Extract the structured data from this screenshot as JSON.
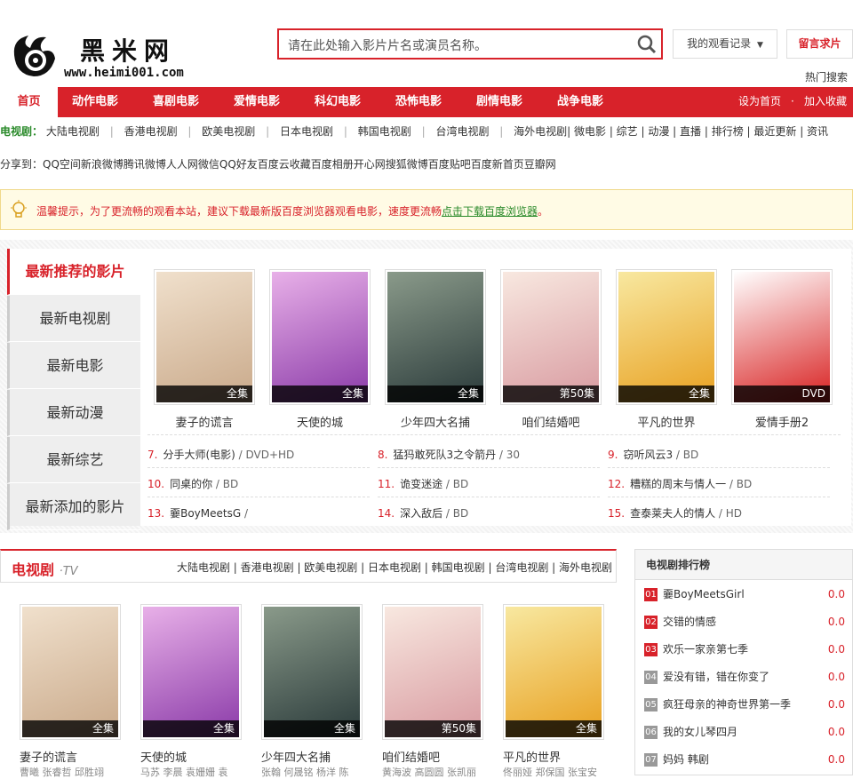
{
  "header": {
    "logo_text": "黑米网",
    "logo_url": "www.heimi001.com",
    "search_placeholder": "请在此处输入影片片名或演员名称。",
    "history_label": "我的观看记录",
    "message_label": "留言求片",
    "hot_search": "热门搜索"
  },
  "nav": {
    "items": [
      "首页",
      "动作电影",
      "喜剧电影",
      "爱情电影",
      "科幻电影",
      "恐怖电影",
      "剧情电影",
      "战争电影"
    ],
    "right": [
      "设为首页",
      "·",
      "加入收藏"
    ]
  },
  "subnav": {
    "label": "电视剧：",
    "items": [
      "大陆电视剧",
      "香港电视剧",
      "欧美电视剧",
      "日本电视剧",
      "韩国电视剧",
      "台湾电视剧"
    ],
    "tail": "海外电视剧| 微电影 | 综艺 | 动漫 | 直播 | 排行榜 | 最近更新 | 资讯"
  },
  "share": "分享到：QQ空间新浪微博腾讯微博人人网微信QQ好友百度云收藏百度相册开心网搜狐微博百度贴吧百度新首页豆瓣网",
  "tip": {
    "text": "温馨提示，为了更流畅的观看本站，建议下载最新版百度浏览器观看电影，速度更流畅",
    "link": "点击下载百度浏览器",
    "end": "。"
  },
  "recommend": {
    "tabs": [
      "最新推荐的影片",
      "最新电视剧",
      "最新电影",
      "最新动漫",
      "最新综艺",
      "最新添加的影片"
    ],
    "posters": [
      {
        "title": "妻子的谎言",
        "badge": "全集",
        "color1": "#c9a98a",
        "color2": "#f0e0cc"
      },
      {
        "title": "天使的城",
        "badge": "全集",
        "color1": "#8a3aa8",
        "color2": "#e8b0e8"
      },
      {
        "title": "少年四大名捕",
        "badge": "全集",
        "color1": "#2a3a3a",
        "color2": "#8a9a8a"
      },
      {
        "title": "咱们结婚吧",
        "badge": "第50集",
        "color1": "#d89aa0",
        "color2": "#f8e8e0"
      },
      {
        "title": "平凡的世界",
        "badge": "全集",
        "color1": "#e8a020",
        "color2": "#f8e8a0"
      },
      {
        "title": "爱情手册2",
        "badge": "DVD",
        "color1": "#d82020",
        "color2": "#ffffff"
      }
    ],
    "list": [
      [
        {
          "n": "7.",
          "t": "分手大师(电影)",
          "v": "DVD+HD"
        },
        {
          "n": "8.",
          "t": "猛犸敢死队3之令箭丹",
          "v": "30"
        },
        {
          "n": "9.",
          "t": "窃听风云3",
          "v": "BD"
        }
      ],
      [
        {
          "n": "10.",
          "t": "同桌的你",
          "v": "BD"
        },
        {
          "n": "11.",
          "t": "诡变迷途",
          "v": "BD"
        },
        {
          "n": "12.",
          "t": "糟糕的周末与情人一",
          "v": "BD"
        }
      ],
      [
        {
          "n": "13.",
          "t": "嫑BoyMeetsG",
          "v": ""
        },
        {
          "n": "14.",
          "t": "深入敌后",
          "v": "BD"
        },
        {
          "n": "15.",
          "t": "查泰莱夫人的情人",
          "v": "HD"
        }
      ]
    ]
  },
  "tv": {
    "title": "电视剧",
    "subtitle": "·TV",
    "links": "大陆电视剧 | 香港电视剧 | 欧美电视剧 | 日本电视剧 | 韩国电视剧 | 台湾电视剧 | 海外电视剧",
    "posters": [
      {
        "title": "妻子的谎言",
        "badge": "全集",
        "cast": "曹曦 张睿哲 邱胜翊",
        "color1": "#c9a98a",
        "color2": "#f0e0cc"
      },
      {
        "title": "天使的城",
        "badge": "全集",
        "cast": "马苏 李晨 袁姗姗 袁",
        "color1": "#8a3aa8",
        "color2": "#e8b0e8"
      },
      {
        "title": "少年四大名捕",
        "badge": "全集",
        "cast": "张翰 何晟铭 杨洋 陈",
        "color1": "#2a3a3a",
        "color2": "#8a9a8a"
      },
      {
        "title": "咱们结婚吧",
        "badge": "第50集",
        "cast": "黄海波 高圆圆 张凯丽",
        "color1": "#d89aa0",
        "color2": "#f8e8e0"
      },
      {
        "title": "平凡的世界",
        "badge": "全集",
        "cast": "佟丽娅 郑保国 张宝安",
        "color1": "#e8a020",
        "color2": "#f8e8a0"
      }
    ]
  },
  "rank": {
    "title": "电视剧排行榜",
    "items": [
      {
        "n": "01",
        "t": "嫑BoyMeetsGirl",
        "s": "0.0"
      },
      {
        "n": "02",
        "t": "交错的情感",
        "s": "0.0"
      },
      {
        "n": "03",
        "t": "欢乐一家亲第七季",
        "s": "0.0"
      },
      {
        "n": "04",
        "t": "爱没有错，错在你变了",
        "s": "0.0"
      },
      {
        "n": "05",
        "t": "疯狂母亲的神奇世界第一季",
        "s": "0.0"
      },
      {
        "n": "06",
        "t": "我的女儿琴四月",
        "s": "0.0"
      },
      {
        "n": "07",
        "t": "妈妈 韩剧",
        "s": "0.0"
      }
    ]
  }
}
